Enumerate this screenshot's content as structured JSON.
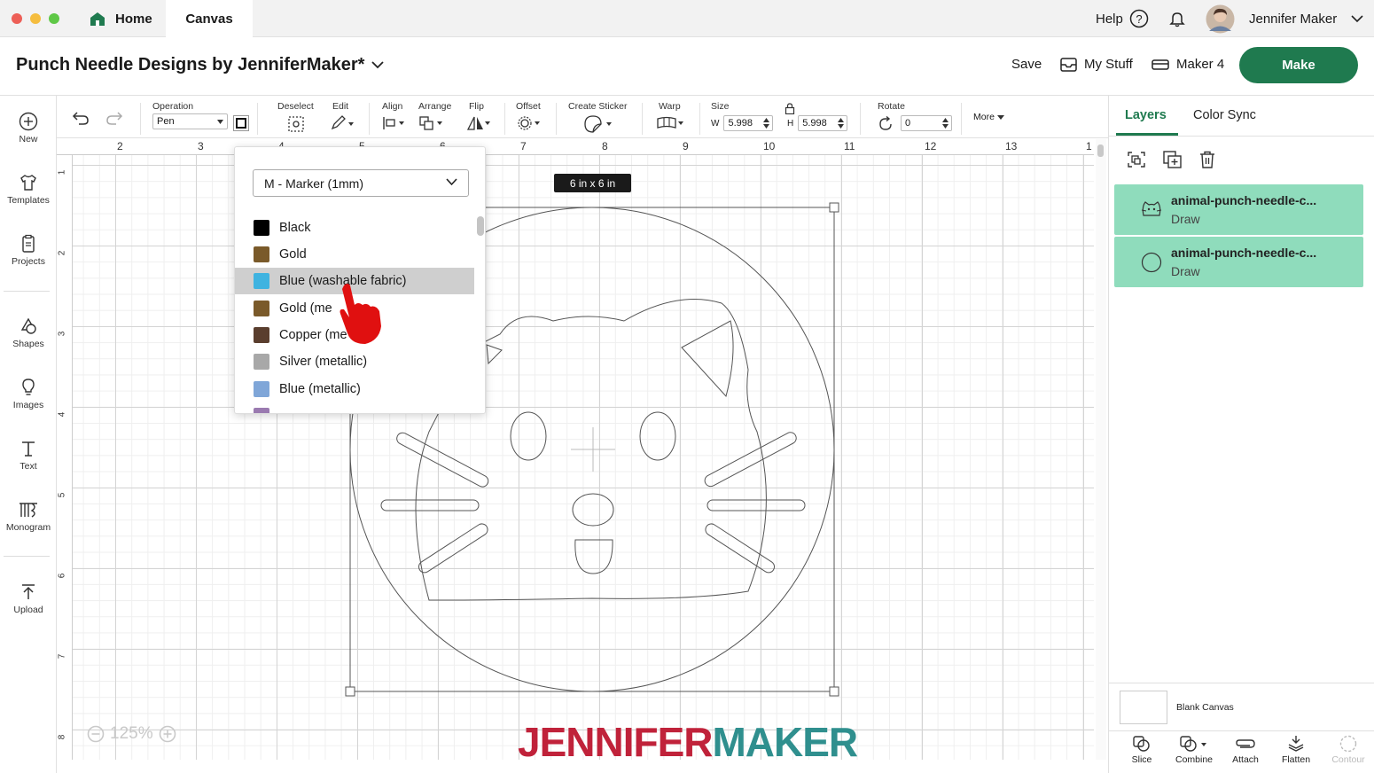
{
  "titlebar": {
    "tabs": [
      {
        "label": "Home"
      },
      {
        "label": "Canvas"
      }
    ],
    "help_label": "Help",
    "user_name": "Jennifer Maker"
  },
  "header": {
    "project_title": "Punch Needle Designs by JenniferMaker*",
    "save_label": "Save",
    "mystuff_label": "My Stuff",
    "machine_label": "Maker 4",
    "make_label": "Make"
  },
  "sidebar": {
    "items": [
      {
        "label": "New",
        "icon": "plus-circle-icon"
      },
      {
        "label": "Templates",
        "icon": "shirt-icon"
      },
      {
        "label": "Projects",
        "icon": "projects-icon"
      },
      {
        "label": "Shapes",
        "icon": "shapes-icon"
      },
      {
        "label": "Images",
        "icon": "lightbulb-icon"
      },
      {
        "label": "Text",
        "icon": "text-icon"
      },
      {
        "label": "Monogram",
        "icon": "monogram-icon"
      },
      {
        "label": "Upload",
        "icon": "upload-icon"
      }
    ]
  },
  "toolbar": {
    "operation_label": "Operation",
    "operation_value": "Pen",
    "deselect_label": "Deselect",
    "edit_label": "Edit",
    "align_label": "Align",
    "arrange_label": "Arrange",
    "flip_label": "Flip",
    "offset_label": "Offset",
    "create_sticker_label": "Create Sticker",
    "warp_label": "Warp",
    "size_label": "Size",
    "w_label": "W",
    "w_value": "5.998",
    "h_label": "H",
    "h_value": "5.998",
    "rotate_label": "Rotate",
    "rotate_value": "0",
    "more_label": "More"
  },
  "canvas": {
    "ruler_top": [
      "2",
      "3",
      "4",
      "5",
      "6",
      "7",
      "8",
      "9",
      "10",
      "11",
      "12",
      "13",
      "1"
    ],
    "ruler_left": [
      "1",
      "2",
      "3",
      "4",
      "5",
      "6",
      "7",
      "8"
    ],
    "size_tag": "6 in x 6 in",
    "zoom_value": "125%",
    "watermark_part1": "JENNIFER",
    "watermark_part2": "MAKER",
    "watermark_color1": "#c0223a",
    "watermark_color2": "#2f8f8e"
  },
  "pen_dropdown": {
    "pen_type": "M - Marker (1mm)",
    "colors": [
      {
        "label": "Black",
        "swatch": "#000000"
      },
      {
        "label": "Gold",
        "swatch": "#7a5a2a"
      },
      {
        "label": "Blue (washable fabric)",
        "swatch": "#3fb3e0",
        "selected": true
      },
      {
        "label": "Gold (me",
        "swatch": "#7a5a2a"
      },
      {
        "label": "Copper (me    c)",
        "swatch": "#5a3e2e"
      },
      {
        "label": "Silver (metallic)",
        "swatch": "#a8a8a8"
      },
      {
        "label": "Blue (metallic)",
        "swatch": "#7fa6d8"
      }
    ]
  },
  "right_panel": {
    "tabs": [
      {
        "label": "Layers"
      },
      {
        "label": "Color Sync"
      }
    ],
    "layers": [
      {
        "name": "animal-punch-needle-c...",
        "type": "Draw",
        "icon": "cat-face-icon"
      },
      {
        "name": "animal-punch-needle-c...",
        "type": "Draw",
        "icon": "circle-icon"
      }
    ],
    "blank_canvas_label": "Blank Canvas",
    "bottom_tools": [
      {
        "label": "Slice"
      },
      {
        "label": "Combine"
      },
      {
        "label": "Attach"
      },
      {
        "label": "Flatten"
      },
      {
        "label": "Contour"
      }
    ]
  },
  "colors": {
    "accent": "#1f7a4f",
    "layer_bg": "#8fdcbc",
    "selected_row": "#cfcfcf"
  }
}
